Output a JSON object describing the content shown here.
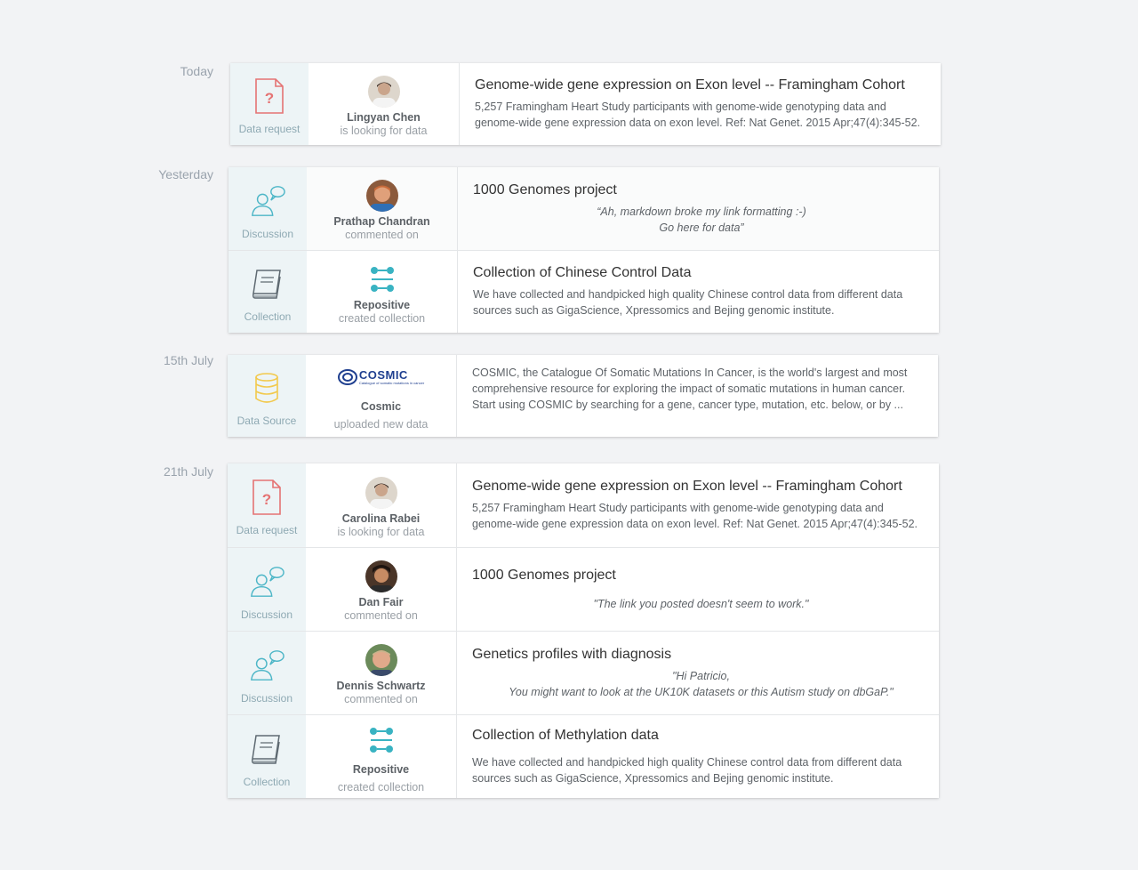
{
  "groups": [
    {
      "date": "Today",
      "items": [
        {
          "type": "Data request",
          "user": "Lingyan Chen",
          "action": "is looking for data",
          "title": "Genome-wide gene expression on Exon level -- Framingham Cohort",
          "description": "5,257 Framingham Heart Study participants with genome-wide genotyping data and genome-wide gene expression data on exon level. Ref: Nat Genet. 2015 Apr;47(4):345-52."
        }
      ]
    },
    {
      "date": "Yesterday",
      "items": [
        {
          "type": "Discussion",
          "user": "Prathap Chandran",
          "action": "commented on",
          "title": "1000 Genomes project",
          "quote_line1": "“Ah, markdown broke my link formatting :-)",
          "quote_line2": "Go here for data”"
        },
        {
          "type": "Collection",
          "user": "Repositive",
          "action": "created collection",
          "title": "Collection of Chinese Control Data",
          "description": "We have collected and handpicked high quality Chinese control data from different data sources such as GigaScience, Xpressomics and Bejing genomic institute."
        }
      ]
    },
    {
      "date": "15th July",
      "items": [
        {
          "type": "Data Source",
          "logo_text": "COSMIC",
          "logo_subtext": "Catalogue of somatic mutations in cancer",
          "user": "Cosmic",
          "action": "uploaded new data",
          "description": "COSMIC, the Catalogue Of Somatic Mutations In Cancer, is the world's largest and most comprehensive resource for exploring the impact of somatic mutations in human cancer. Start using COSMIC by searching for a gene, cancer type, mutation, etc. below, or by ..."
        }
      ]
    },
    {
      "date": "21th July",
      "items": [
        {
          "type": "Data request",
          "user": "Carolina Rabei",
          "action": "is looking for data",
          "title": "Genome-wide gene expression on Exon level -- Framingham Cohort",
          "description": "5,257 Framingham Heart Study participants with genome-wide genotyping data and genome-wide gene expression data on exon level. Ref: Nat Genet. 2015 Apr;47(4):345-52."
        },
        {
          "type": "Discussion",
          "user": "Dan Fair",
          "action": "commented on",
          "title": "1000 Genomes project",
          "quote_line1": "\"The link you posted doesn't seem to work.\""
        },
        {
          "type": "Discussion",
          "user": "Dennis Schwartz",
          "action": "commented on",
          "title": "Genetics profiles with diagnosis",
          "quote_line1": "\"Hi Patricio,",
          "quote_line2": "You might want to look at the UK10K datasets or this Autism study on dbGaP.\""
        },
        {
          "type": "Collection",
          "user": "Repositive",
          "action": "created collection",
          "title": "Collection of Methylation data",
          "description": "We have collected and handpicked high quality Chinese control data from different data sources such as GigaScience, Xpressomics and Bejing genomic institute."
        }
      ]
    }
  ],
  "colors": {
    "request_icon": "#e57373",
    "discussion_icon": "#4db6c7",
    "collection_icon": "#5f6a72",
    "datasource_icon": "#f2c94c",
    "repositive_icon": "#39b3c2",
    "cosmic_logo": "#1f3f8f"
  }
}
